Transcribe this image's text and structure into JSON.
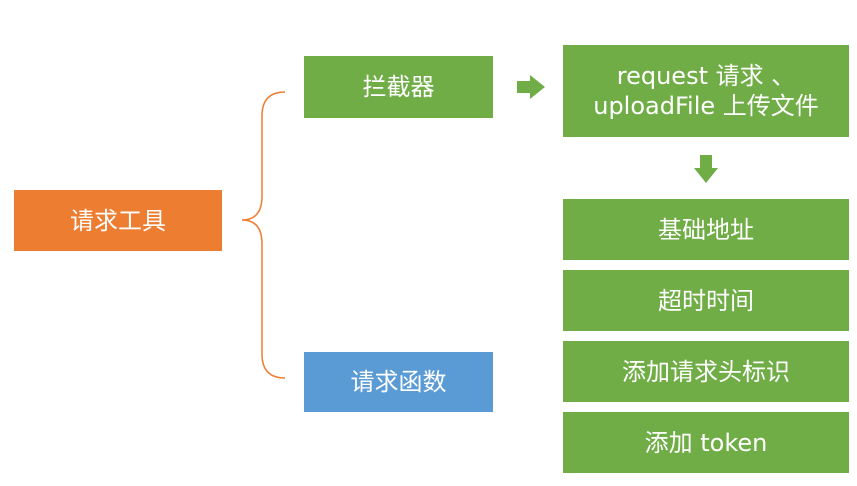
{
  "root": {
    "label": "请求工具"
  },
  "branches": {
    "interceptor": "拦截器",
    "request_function": "请求函数"
  },
  "target": {
    "line1": "request 请求 、",
    "line2": "uploadFile 上传文件"
  },
  "config_items": [
    "基础地址",
    "超时时间",
    "添加请求头标识",
    "添加 token"
  ],
  "colors": {
    "orange": "#ED7D31",
    "green": "#70AD47",
    "blue": "#5B9BD5",
    "brace": "#ED7D31"
  }
}
